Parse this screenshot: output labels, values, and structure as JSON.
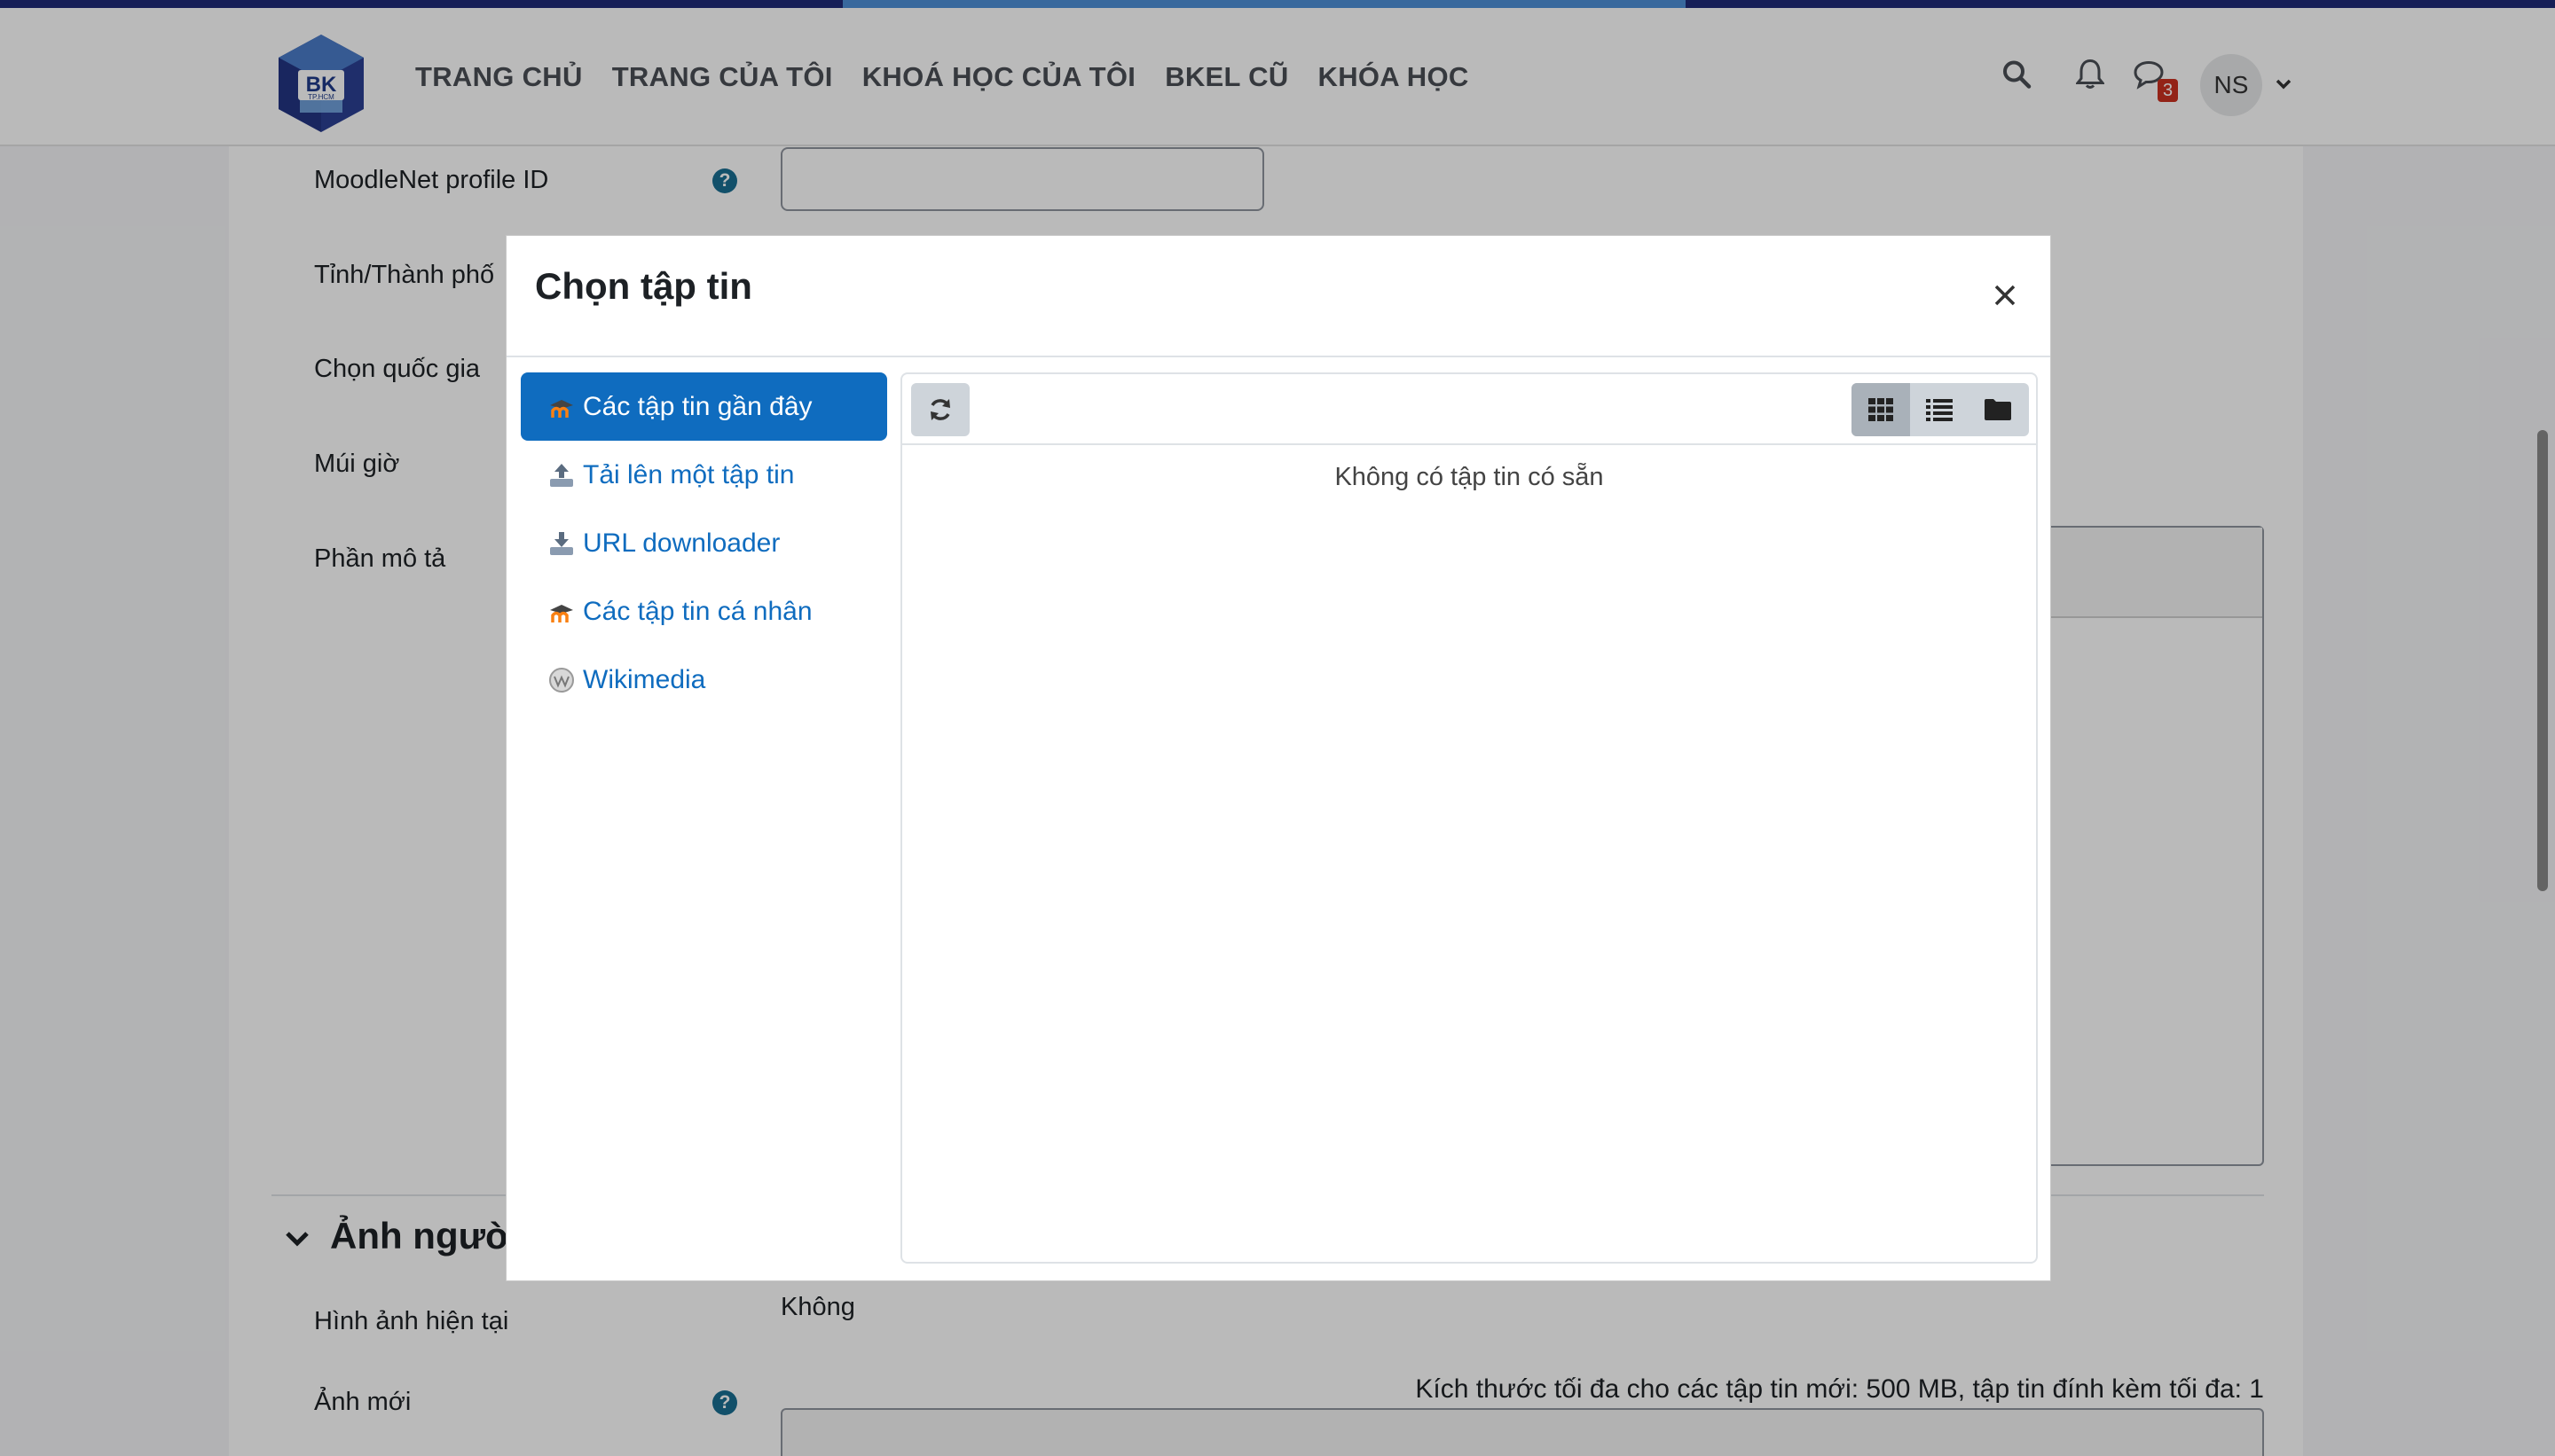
{
  "navbar": {
    "logo_text": "BK",
    "logo_sub": "TP.HCM",
    "links": [
      "TRANG CHỦ",
      "TRANG CỦA TÔI",
      "KHOÁ HỌC CỦA TÔI",
      "BKEL CŨ",
      "KHÓA HỌC"
    ],
    "messages_count": "3",
    "user_initials": "NS"
  },
  "form": {
    "labels": {
      "moodlenet": "MoodleNet profile ID",
      "city": "Tỉnh/Thành phố",
      "country": "Chọn quốc gia",
      "timezone": "Múi giờ",
      "description": "Phần mô tả",
      "current_picture": "Hình ảnh hiện tại",
      "new_picture": "Ảnh mới"
    },
    "section_title": "Ảnh người",
    "current_picture_value": "Không",
    "max_size_note": "Kích thước tối đa cho các tập tin mới: 500 MB, tập tin đính kèm tối đa: 1",
    "help_glyph": "?"
  },
  "modal": {
    "title": "Chọn tập tin",
    "repositories": [
      {
        "label": "Các tập tin gần đây",
        "icon": "moodle-icon",
        "active": true
      },
      {
        "label": "Tải lên một tập tin",
        "icon": "upload-icon",
        "active": false
      },
      {
        "label": "URL downloader",
        "icon": "download-icon",
        "active": false
      },
      {
        "label": "Các tập tin cá nhân",
        "icon": "moodle-icon",
        "active": false
      },
      {
        "label": "Wikimedia",
        "icon": "wikimedia-icon",
        "active": false
      }
    ],
    "empty_message": "Không có tập tin có sẵn"
  },
  "colors": {
    "primary": "#0f6cbf",
    "nav_text": "#4a4f55",
    "badge": "#ca3120"
  }
}
